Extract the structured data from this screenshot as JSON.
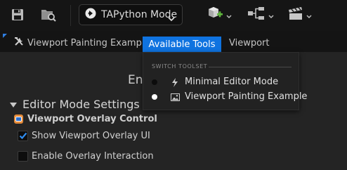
{
  "toolbar": {
    "mode_label": "TAPython Mode",
    "icons": [
      "save-icon",
      "content-browser-icon",
      "mode-icon",
      "chevron-down-icon",
      "add-actor-icon",
      "blueprint-icon",
      "cinematics-icon"
    ]
  },
  "tabs": [
    {
      "label": "Viewport Painting Example",
      "icon": "tools-icon",
      "active": false
    },
    {
      "label": "Available Tools",
      "active": true
    },
    {
      "label": "Viewport",
      "active": false
    }
  ],
  "panel": {
    "title": "En",
    "section_title": "Editor Mode Settings",
    "overlay_heading": "Viewport Overlay Control",
    "checkboxes": [
      {
        "label": "Show Viewport Overlay UI",
        "checked": true
      },
      {
        "label": "Enable Overlay Interaction",
        "checked": false
      }
    ]
  },
  "menu": {
    "section_label": "SWITCH TOOLSET",
    "items": [
      {
        "label": "Minimal Editor Mode",
        "icon": "lightning-icon",
        "selected": false
      },
      {
        "label": "Viewport Painting Example",
        "icon": "image-icon",
        "selected": true
      }
    ]
  },
  "colors": {
    "accent": "#0f73e0",
    "checkbox_check": "#2f8cf0",
    "overlay_icon": "#e58b3a",
    "add_actor_plus": "#5fb83c"
  }
}
